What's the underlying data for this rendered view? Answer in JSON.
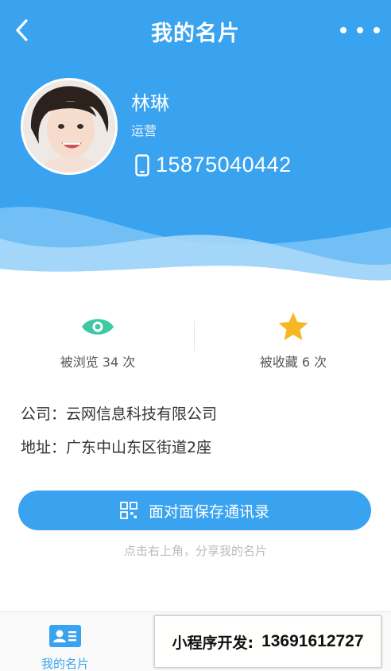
{
  "header": {
    "title": "我的名片",
    "back_icon": "chevron-left-icon",
    "more_icon": "more-dots-icon",
    "bg_color": "#3aa3f0"
  },
  "profile": {
    "name": "林琳",
    "role": "运营",
    "phone": "15875040442",
    "phone_icon": "phone-icon"
  },
  "stats": {
    "views_label": "被浏览 34 次",
    "views_icon": "eye-icon",
    "favorites_label": "被收藏 6 次",
    "favorites_icon": "star-icon",
    "eye_color": "#3cc9a4",
    "star_color": "#f6b822"
  },
  "info": {
    "company": "公司：云网信息科技有限公司",
    "address": "地址：广东中山东区街道2座"
  },
  "actions": {
    "save_label": "面对面保存通讯录",
    "save_icon": "qr-code-icon",
    "hint": "点击右上角，分享我的名片"
  },
  "tabbar": {
    "items": [
      {
        "label": "我的名片",
        "icon": "contact-card-icon",
        "active": true
      },
      {
        "label": "",
        "active": false
      }
    ]
  },
  "promo": {
    "text": "小程序开发:",
    "number": "13691612727"
  }
}
